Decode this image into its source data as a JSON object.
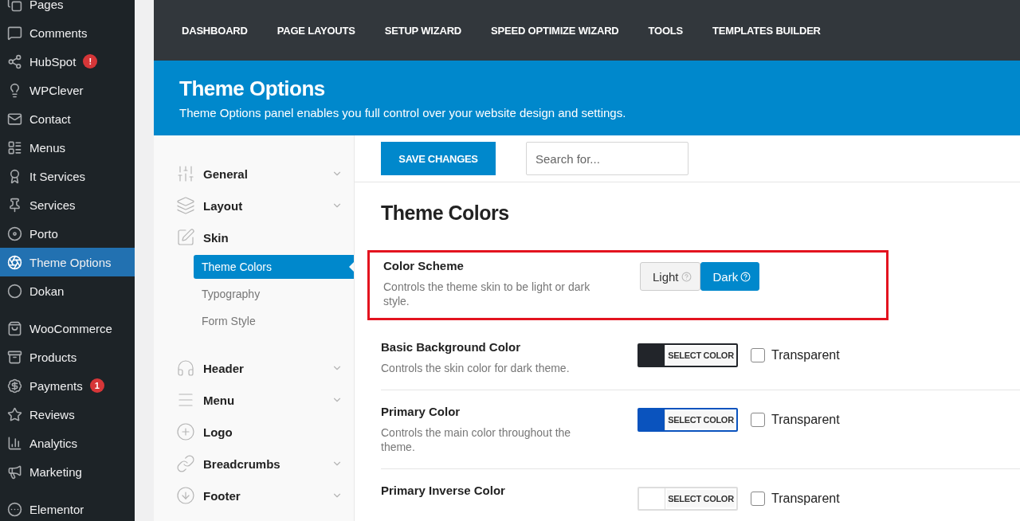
{
  "admin_menu": {
    "groups": [
      {
        "items": [
          {
            "label": "Pages",
            "selected": false
          },
          {
            "label": "Comments",
            "selected": false
          },
          {
            "label": "HubSpot",
            "badge": "!",
            "selected": false
          },
          {
            "label": "WPClever",
            "selected": false
          },
          {
            "label": "Contact",
            "selected": false
          },
          {
            "label": "Menus",
            "selected": false
          },
          {
            "label": "It Services",
            "selected": false
          },
          {
            "label": "Services",
            "selected": false
          },
          {
            "label": "Porto",
            "selected": false
          },
          {
            "label": "Theme Options",
            "selected": true
          },
          {
            "label": "Dokan",
            "selected": false
          }
        ]
      },
      {
        "items": [
          {
            "label": "WooCommerce",
            "selected": false
          },
          {
            "label": "Products",
            "selected": false
          },
          {
            "label": "Payments",
            "badge": "1",
            "selected": false
          },
          {
            "label": "Reviews",
            "selected": false
          },
          {
            "label": "Analytics",
            "selected": false
          },
          {
            "label": "Marketing",
            "selected": false
          }
        ]
      },
      {
        "items": [
          {
            "label": "Elementor",
            "selected": false
          }
        ]
      }
    ]
  },
  "top_nav": [
    "DASHBOARD",
    "PAGE LAYOUTS",
    "SETUP WIZARD",
    "SPEED OPTIMIZE WIZARD",
    "TOOLS",
    "TEMPLATES BUILDER"
  ],
  "header": {
    "title": "Theme Options",
    "subtitle": "Theme Options panel enables you full control over your website design and settings."
  },
  "options_nav": [
    {
      "label": "General",
      "expanded": false
    },
    {
      "label": "Layout",
      "expanded": false
    },
    {
      "label": "Skin",
      "expanded": true,
      "children": [
        {
          "label": "Theme Colors",
          "selected": true
        },
        {
          "label": "Typography",
          "selected": false
        },
        {
          "label": "Form Style",
          "selected": false
        }
      ]
    },
    {
      "label": "Header",
      "expanded": false
    },
    {
      "label": "Menu",
      "expanded": false
    },
    {
      "label": "Logo"
    },
    {
      "label": "Breadcrumbs",
      "expanded": false
    },
    {
      "label": "Footer",
      "expanded": false
    }
  ],
  "toolbar": {
    "save_button": "SAVE CHANGES",
    "search": {
      "placeholder": "Search for..."
    }
  },
  "section_title": "Theme Colors",
  "options": [
    {
      "kind": "toggle",
      "title": "Color Scheme",
      "description": "Controls the theme skin to be light or dark style.",
      "highlighted": true,
      "choices": [
        {
          "label": "Light",
          "selected": false
        },
        {
          "label": "Dark",
          "selected": true
        }
      ]
    },
    {
      "kind": "color",
      "title": "Basic Background Color",
      "description": "Controls the skin color for dark theme.",
      "highlighted": false,
      "color": "#22252a",
      "button": "SELECT COLOR",
      "transparent": {
        "label": "Transparent",
        "checked": false
      }
    },
    {
      "kind": "color",
      "title": "Primary Color",
      "description": "Controls the main color throughout the theme.",
      "highlighted": false,
      "color": "#0a53be",
      "button": "SELECT COLOR",
      "transparent": {
        "label": "Transparent",
        "checked": false
      }
    },
    {
      "kind": "color",
      "title": "Primary Inverse Color",
      "highlighted": false,
      "color": "#ffffff",
      "button": "SELECT COLOR",
      "transparent": {
        "label": "Transparent",
        "checked": false
      }
    }
  ]
}
